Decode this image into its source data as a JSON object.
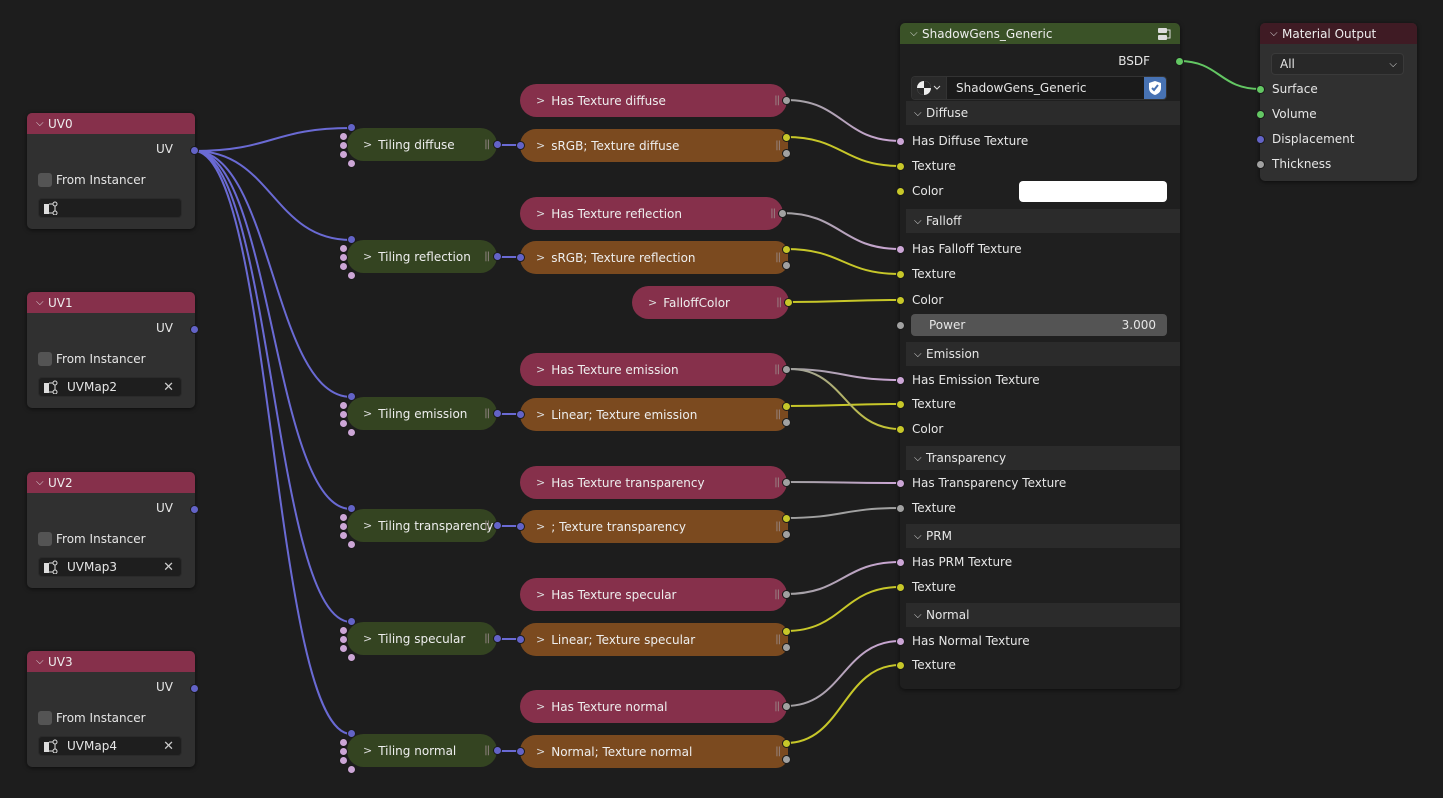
{
  "uv_nodes": [
    {
      "title": "UV0",
      "output": "UV",
      "checkbox_label": "From Instancer",
      "uv_map": ""
    },
    {
      "title": "UV1",
      "output": "UV",
      "checkbox_label": "From Instancer",
      "uv_map": "UVMap2"
    },
    {
      "title": "UV2",
      "output": "UV",
      "checkbox_label": "From Instancer",
      "uv_map": "UVMap3"
    },
    {
      "title": "UV3",
      "output": "UV",
      "checkbox_label": "From Instancer",
      "uv_map": "UVMap4"
    }
  ],
  "tiling_groups": [
    {
      "label": "Tiling diffuse"
    },
    {
      "label": "Tiling reflection"
    },
    {
      "label": "Tiling emission"
    },
    {
      "label": "Tiling transparency"
    },
    {
      "label": "Tiling specular"
    },
    {
      "label": "Tiling normal"
    }
  ],
  "has_texture_groups": [
    {
      "label": "Has Texture diffuse"
    },
    {
      "label": "Has Texture reflection"
    },
    {
      "label": "Has Texture emission"
    },
    {
      "label": "Has Texture transparency"
    },
    {
      "label": "Has Texture specular"
    },
    {
      "label": "Has Texture normal"
    }
  ],
  "texture_groups": [
    {
      "label": "sRGB; Texture diffuse"
    },
    {
      "label": "sRGB; Texture reflection"
    },
    {
      "label": "Linear; Texture emission"
    },
    {
      "label": "; Texture transparency"
    },
    {
      "label": "Linear; Texture specular"
    },
    {
      "label": "Normal; Texture normal"
    }
  ],
  "falloff_color_group": {
    "label": "FalloffColor"
  },
  "shader_group": {
    "title": "ShadowGens_Generic",
    "output": "BSDF",
    "material_name": "ShadowGens_Generic",
    "panels": {
      "diffuse": {
        "title": "Diffuse",
        "inputs": [
          "Has Diffuse Texture",
          "Texture",
          "Color"
        ]
      },
      "falloff": {
        "title": "Falloff",
        "inputs": [
          "Has Falloff Texture",
          "Texture",
          "Color"
        ],
        "power_label": "Power",
        "power_value": "3.000"
      },
      "emission": {
        "title": "Emission",
        "inputs": [
          "Has Emission Texture",
          "Texture",
          "Color"
        ]
      },
      "transparency": {
        "title": "Transparency",
        "inputs": [
          "Has Transparency Texture",
          "Texture"
        ]
      },
      "prm": {
        "title": "PRM",
        "inputs": [
          "Has PRM Texture",
          "Texture"
        ]
      },
      "normal": {
        "title": "Normal",
        "inputs": [
          "Has Normal Texture",
          "Texture"
        ]
      }
    },
    "diffuse_color": "#ffffff"
  },
  "material_output": {
    "title": "Material Output",
    "target": "All",
    "inputs": [
      "Surface",
      "Volume",
      "Displacement",
      "Thickness"
    ]
  },
  "colors": {
    "uv_socket": "#6363c7",
    "bool_socket": "#cca6d6",
    "color_socket": "#c7c729",
    "float_socket": "#a1a1a1",
    "shader_socket": "#63c763"
  }
}
